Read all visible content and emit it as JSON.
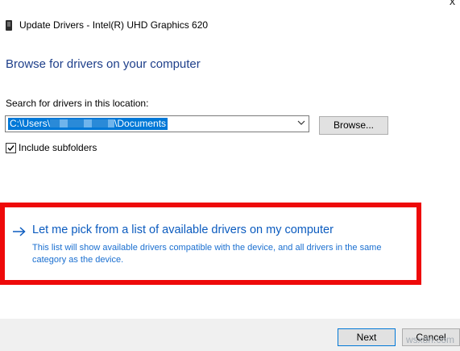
{
  "window": {
    "title": "Update Drivers - Intel(R) UHD Graphics 620",
    "close_glyph": "x"
  },
  "heading": "Browse for drivers on your computer",
  "search": {
    "label": "Search for drivers in this location:",
    "path_prefix": "C:\\Users\\",
    "path_suffix": "\\Documents",
    "browse_label": "Browse...",
    "include_subfolders_label": "Include subfolders",
    "include_subfolders_checked": true
  },
  "pick_option": {
    "link": "Let me pick from a list of available drivers on my computer",
    "description": "This list will show available drivers compatible with the device, and all drivers in the same category as the device."
  },
  "footer": {
    "next_label": "Next",
    "cancel_label": "Cancel"
  },
  "watermark": "wsxdn.com",
  "colors": {
    "heading": "#1e3f8a",
    "link": "#0b5bbf",
    "selection": "#0078d7",
    "highlight_frame": "#ee0a0a"
  }
}
